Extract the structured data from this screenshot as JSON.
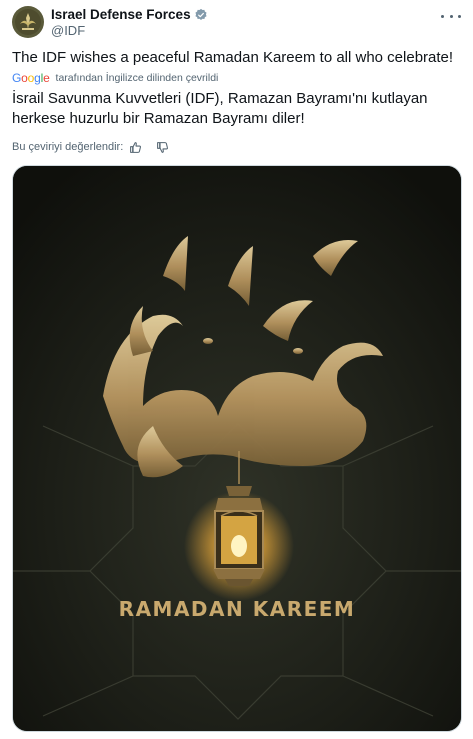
{
  "author": {
    "display_name": "Israel Defense Forces",
    "handle": "@IDF",
    "verified_icon": "verified-badge-icon",
    "avatar_icon": "idf-emblem-icon"
  },
  "tweet": {
    "text": "The IDF wishes a peaceful Ramadan Kareem to all who celebrate!",
    "translation_credit": "tarafından İngilizce dilinden çevrildi",
    "google_label": "Google",
    "translated_text": "İsrail Savunma Kuvvetleri (IDF), Ramazan Bayramı'nı kutlayan herkese huzurlu bir Ramazan Bayramı diler!",
    "rate_prompt": "Bu çeviriyi değerlendir:"
  },
  "media": {
    "caption_text": "RAMADAN KAREEM",
    "colors": {
      "background": "#1a1c16",
      "gold": "#c9a96e",
      "glow": "#ffcf5a"
    }
  },
  "colors": {
    "text_primary": "#0f1419",
    "text_secondary": "#536471",
    "verified": "#829aab"
  }
}
